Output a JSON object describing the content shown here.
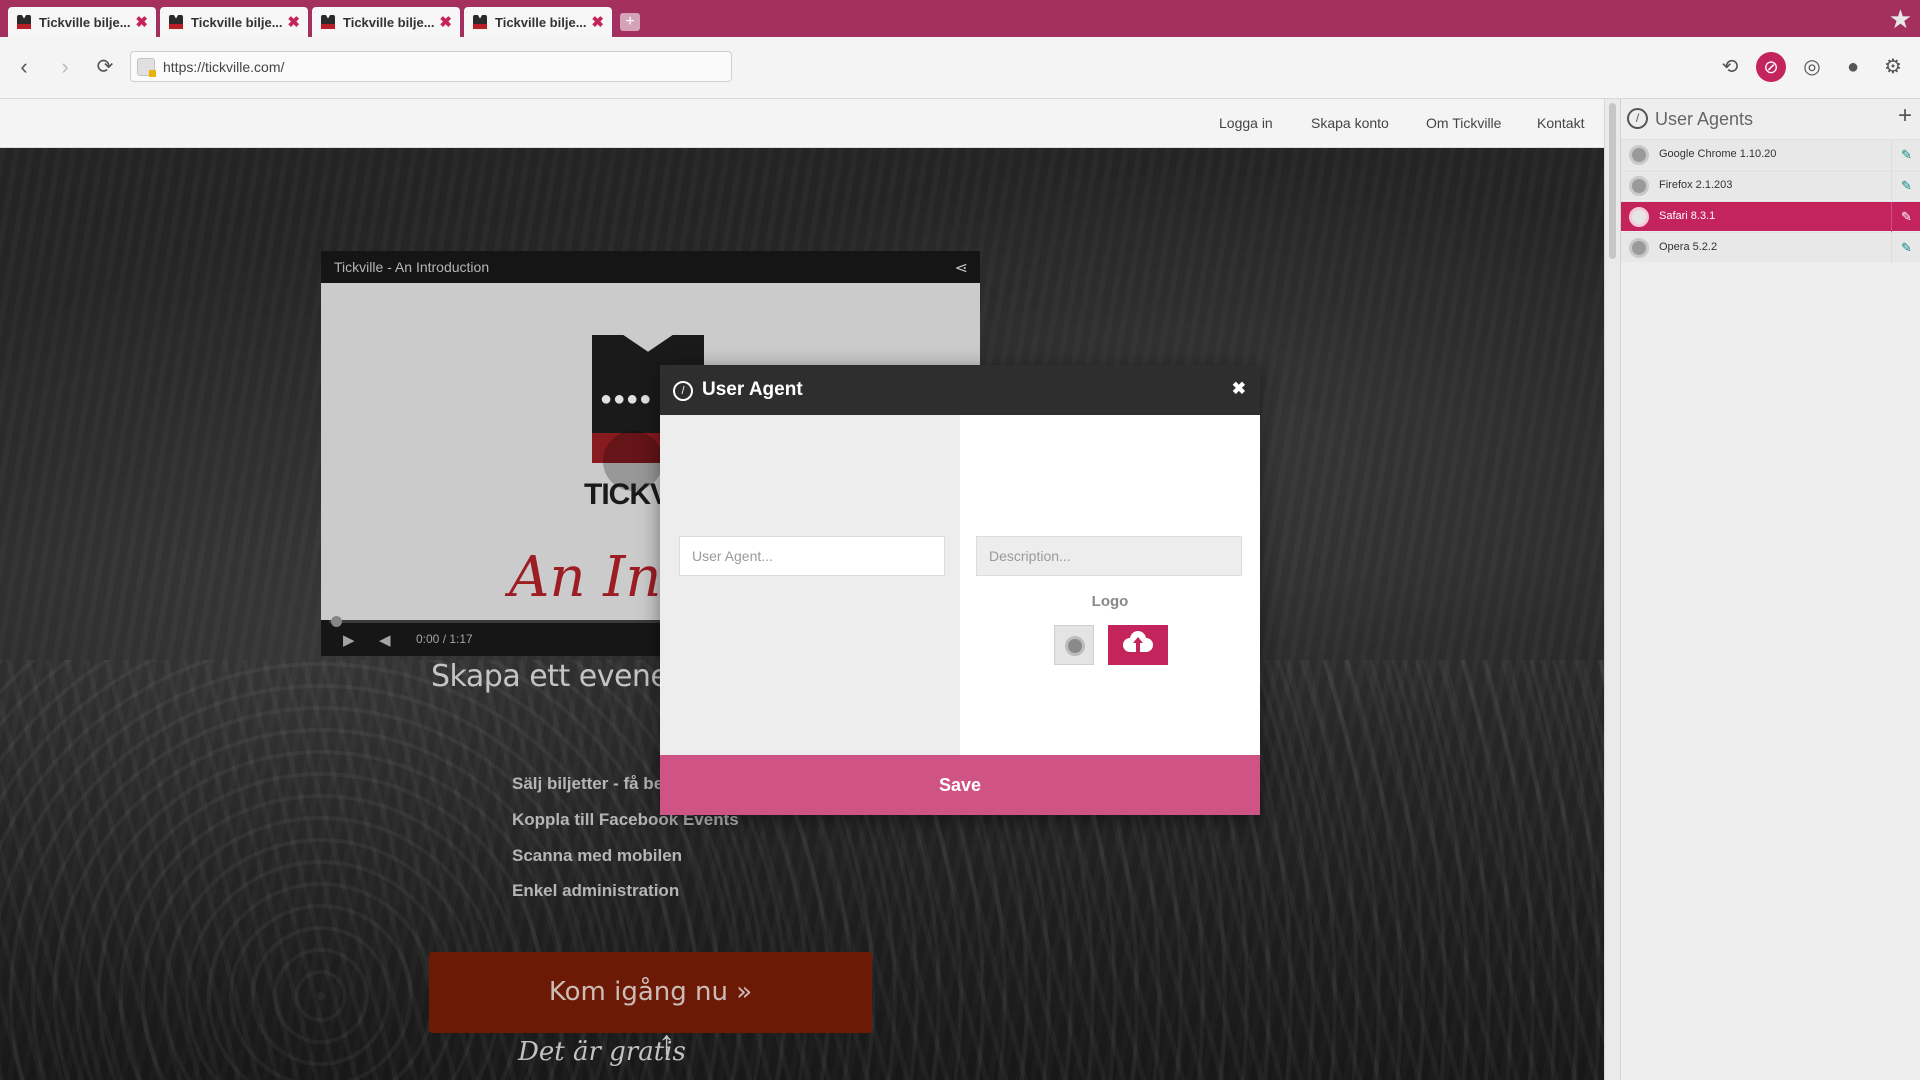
{
  "browser": {
    "tabs": [
      {
        "label": "Tickville bilje...",
        "close": "✖"
      },
      {
        "label": "Tickville bilje...",
        "close": "✖"
      },
      {
        "label": "Tickville bilje...",
        "close": "✖"
      },
      {
        "label": "Tickville bilje...",
        "close": "✖"
      }
    ],
    "new_tab": "+",
    "url": "https://tickville.com/"
  },
  "site": {
    "nav": [
      "Logga in",
      "Skapa konto",
      "Om Tickville",
      "Kontakt"
    ],
    "video": {
      "title": "Tickville - An Introduction",
      "brand": "TICKV",
      "script_text": "An Intr",
      "time": "0:00 / 1:17"
    },
    "heading": "Skapa ett evenema",
    "features": [
      "Sälj biljetter - få bet",
      "Koppla till Facebook Events",
      "Scanna med mobilen",
      "Enkel administration"
    ],
    "cta": "Kom igång nu »",
    "free_note": "Det är gratis"
  },
  "sidebar": {
    "title": "User Agents",
    "items": [
      {
        "label": "Google Chrome 1.10.20",
        "selected": false
      },
      {
        "label": "Firefox 2.1.203",
        "selected": false
      },
      {
        "label": "Safari 8.3.1",
        "selected": true
      },
      {
        "label": "Opera 5.2.2",
        "selected": false
      }
    ]
  },
  "modal": {
    "title": "User Agent",
    "user_agent_placeholder": "User Agent...",
    "description_placeholder": "Description...",
    "logo_label": "Logo",
    "save_label": "Save"
  },
  "colors": {
    "accent": "#c4245c",
    "tab_strip": "#a3305f",
    "save_button": "#cf5384",
    "cta_button": "#7c1d07",
    "edit_icon": "#0c8a8a"
  }
}
